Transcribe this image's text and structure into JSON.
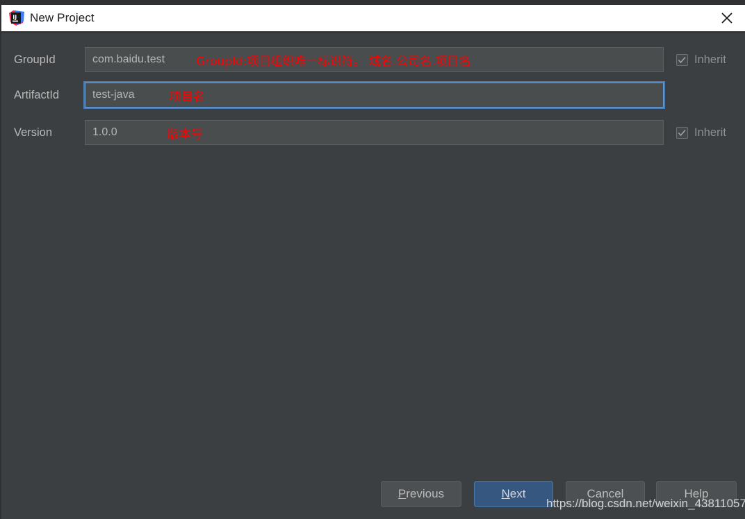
{
  "window": {
    "title": "New Project",
    "app_icon": "intellij-idea-icon",
    "close_icon": "close-icon",
    "background_color": "#3c3f41",
    "titlebar_color": "#ffffff"
  },
  "form": {
    "fields": [
      {
        "label": "GroupId",
        "value": "com.baidu.test",
        "annotation": "GroupId:项目组织唯一标识符。  域名.公司名.项目名",
        "focused": false,
        "inherit": {
          "label": "Inherit",
          "checked": true,
          "enabled": false
        }
      },
      {
        "label": "ArtifactId",
        "value": "test-java",
        "annotation": "项目名",
        "focused": true,
        "inherit": null
      },
      {
        "label": "Version",
        "value": "1.0.0",
        "annotation": "版本号",
        "focused": false,
        "inherit": {
          "label": "Inherit",
          "checked": true,
          "enabled": false
        }
      }
    ]
  },
  "buttons": {
    "previous": {
      "label": "Previous",
      "mnemonic": "P",
      "rest": "revious"
    },
    "next": {
      "label": "Next",
      "mnemonic": "N",
      "rest": "ext",
      "primary": true,
      "color": "#365880"
    },
    "cancel": {
      "label": "Cancel"
    },
    "help": {
      "label": "Help"
    }
  },
  "watermark": {
    "text": "https://blog.csdn.net/weixin_43811057"
  },
  "colors": {
    "panel": "#3c3f41",
    "input": "#4a4d4e",
    "accent": "#365880",
    "focus_ring": "#4a7eb5",
    "annotation": "#ff0000",
    "label_text": "#b9b9b9"
  }
}
